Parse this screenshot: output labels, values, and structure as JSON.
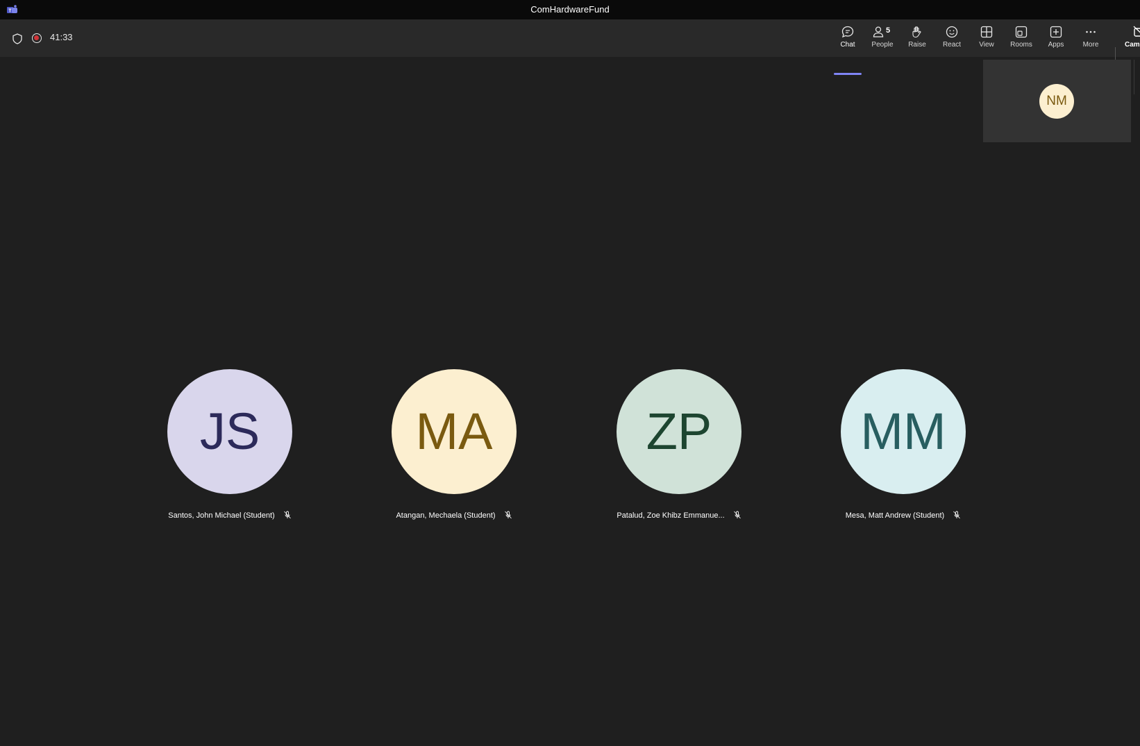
{
  "window": {
    "title": "ComHardwareFund",
    "app_icon": "teams-icon"
  },
  "meeting": {
    "timer": "41:33",
    "recording": true,
    "accent_color": "#7f85f5"
  },
  "toolbar": {
    "chat": {
      "label": "Chat",
      "icon": "chat-icon",
      "active": true
    },
    "people": {
      "label": "People",
      "icon": "people-icon",
      "count": "5"
    },
    "raise": {
      "label": "Raise",
      "icon": "hand-icon"
    },
    "react": {
      "label": "React",
      "icon": "emoji-icon"
    },
    "view": {
      "label": "View",
      "icon": "grid-icon"
    },
    "rooms": {
      "label": "Rooms",
      "icon": "rooms-icon"
    },
    "apps": {
      "label": "Apps",
      "icon": "plus-icon"
    },
    "more": {
      "label": "More",
      "icon": "ellipsis-icon"
    },
    "camera": {
      "label": "Cam",
      "icon": "camera-off-icon"
    }
  },
  "self_view": {
    "initials": "NM",
    "bg": "#fcefd0",
    "fg": "#7a5a10"
  },
  "participants": [
    {
      "initials": "JS",
      "name": "Santos, John Michael (Student)",
      "muted": true,
      "bg": "#d9d6ec",
      "fg": "#2c2a5a"
    },
    {
      "initials": "MA",
      "name": "Atangan, Mechaela (Student)",
      "muted": true,
      "bg": "#fcefd0",
      "fg": "#7a5a10"
    },
    {
      "initials": "ZP",
      "name": "Patalud, Zoe Khibz Emmanue...",
      "muted": true,
      "bg": "#d0e2d8",
      "fg": "#1d4530"
    },
    {
      "initials": "MM",
      "name": "Mesa, Matt Andrew (Student)",
      "muted": true,
      "bg": "#d9eef0",
      "fg": "#285e60"
    }
  ]
}
